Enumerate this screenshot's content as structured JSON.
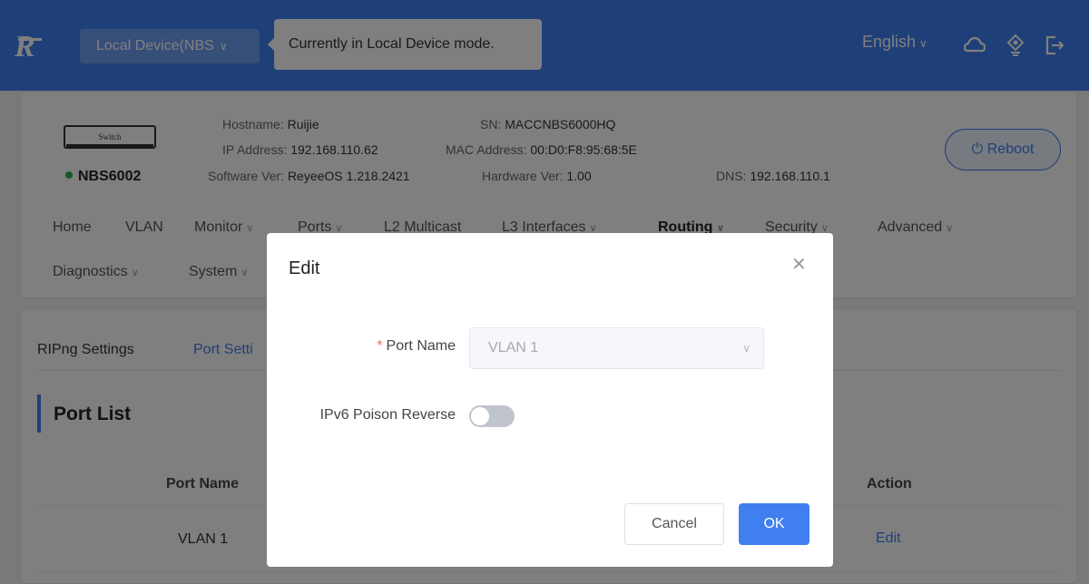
{
  "topbar": {
    "logo_icon": "ruijie-r-logo",
    "device_selector": "Local Device(NBS",
    "tooltip": "Currently in Local Device mode.",
    "language": "English",
    "icons": [
      "cloud-icon",
      "network-icon",
      "logout-icon"
    ]
  },
  "device": {
    "switch_image_label": "Switch",
    "model": "NBS6002",
    "status_color": "#2db24a",
    "hostname_label": "Hostname:",
    "hostname": "Ruijie",
    "ip_label": "IP Address:",
    "ip": "192.168.110.62",
    "software_label": "Software Ver:",
    "software": "ReyeeOS 1.218.2421",
    "sn_label": "SN:",
    "sn": "MACCNBS6000HQ",
    "mac_label": "MAC Address:",
    "mac": "00:D0:F8:95:68:5E",
    "hardware_label": "Hardware Ver:",
    "hardware": "1.00",
    "dns_label": "DNS:",
    "dns": "192.168.110.1",
    "reboot_label": "Reboot"
  },
  "nav": {
    "home": "Home",
    "vlan": "VLAN",
    "monitor": "Monitor",
    "ports": "Ports",
    "l2_multicast": "L2 Multicast",
    "l3_interfaces": "L3 Interfaces",
    "routing": "Routing",
    "security": "Security",
    "advanced": "Advanced",
    "diagnostics": "Diagnostics",
    "system": "System"
  },
  "content": {
    "tabs": [
      "RIPng Settings",
      "Port Setti"
    ],
    "section_title": "Port List",
    "columns": {
      "port_name": "Port Name",
      "action": "Action"
    },
    "rows": [
      {
        "port_name": "VLAN 1",
        "action": "Edit"
      }
    ]
  },
  "modal": {
    "title": "Edit",
    "port_name_label": "Port Name",
    "port_name_value": "VLAN 1",
    "poison_reverse_label": "IPv6 Poison Reverse",
    "poison_reverse_enabled": false,
    "cancel": "Cancel",
    "ok": "OK"
  },
  "colors": {
    "brand": "#3f7ff0",
    "required": "#f56c6c"
  }
}
